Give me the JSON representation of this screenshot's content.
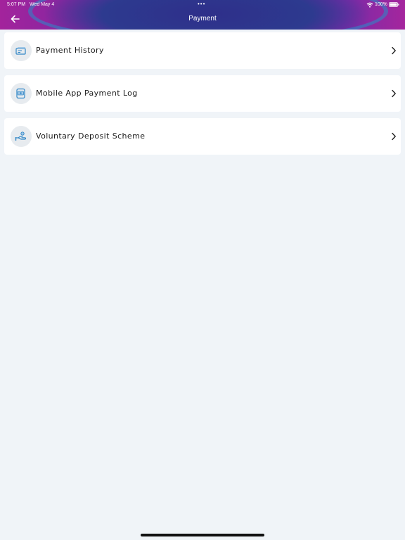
{
  "status_bar": {
    "time": "5:07 PM",
    "date": "Wed May 4",
    "dots": "•••",
    "battery": "100%"
  },
  "header": {
    "title": "Payment"
  },
  "menu": [
    {
      "label": "Payment History",
      "icon": "payment-history-icon"
    },
    {
      "label": "Mobile App Payment Log",
      "icon": "mobile-app-payment-log-icon"
    },
    {
      "label": "Voluntary Deposit Scheme",
      "icon": "voluntary-deposit-icon"
    }
  ],
  "colors": {
    "header_start": "#a3239c",
    "header_mid": "#452b95",
    "background": "#f0f4f8",
    "card": "#ffffff",
    "icon_accent": "#2f86c6"
  }
}
